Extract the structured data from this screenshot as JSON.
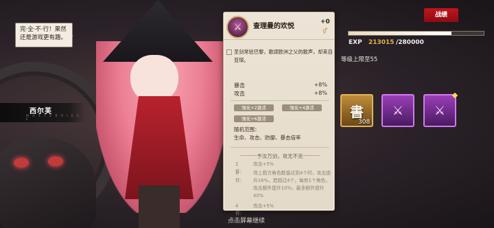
{
  "speech": {
    "text": "完·全·不·行！果然还是游戏更有趣。"
  },
  "character": {
    "name": "西尔芙",
    "name_en": "M A S T E R P I E C E"
  },
  "hint": "点击屏幕继续",
  "item": {
    "icon": "sword-icon",
    "title": "查理曼的欢悦",
    "plus": "+0",
    "gender": "⚥",
    "description": "圣剑常驻巴黎，歌颂欧洲之父的歌声，却来自亚琛。",
    "stats": [
      {
        "label": "暴击",
        "value": "+8%"
      },
      {
        "label": "攻击",
        "value": "+8%"
      }
    ],
    "tags": [
      "强化+2激活",
      "强化+4激活",
      "强化+6激活"
    ],
    "random_label": "随机范围：",
    "random_value": "生命、攻击、防御、暴击倍率",
    "set_title": "予汝万剑，攻无不克",
    "set_bonuses": [
      {
        "key": "2件:",
        "text": "攻击+5%"
      },
      {
        "key": "3件:",
        "text": "场上我方角色数量达到4个时，攻击提升16%，若超过4个，每有1个角色，攻击额外提升10%，最多额外提升40%"
      },
      {
        "key": "4件:",
        "text": "攻击+5%"
      }
    ]
  },
  "battle_button": "战绩",
  "exp": {
    "label": "EXP",
    "current": "213015",
    "max": "/280000",
    "progress": 0.761
  },
  "level_cap": "等级上限至55",
  "slots": [
    {
      "icon": "book-icon",
      "glyph": "書",
      "count": "308"
    },
    {
      "icon": "sword-icon",
      "glyph": "⚔",
      "count": ""
    },
    {
      "icon": "sword-icon",
      "glyph": "⚔",
      "count": ""
    }
  ],
  "colors": {
    "accent_red": "#c3141c",
    "exp_gold": "#e5b34a",
    "card_bg": "#ece4d6"
  }
}
